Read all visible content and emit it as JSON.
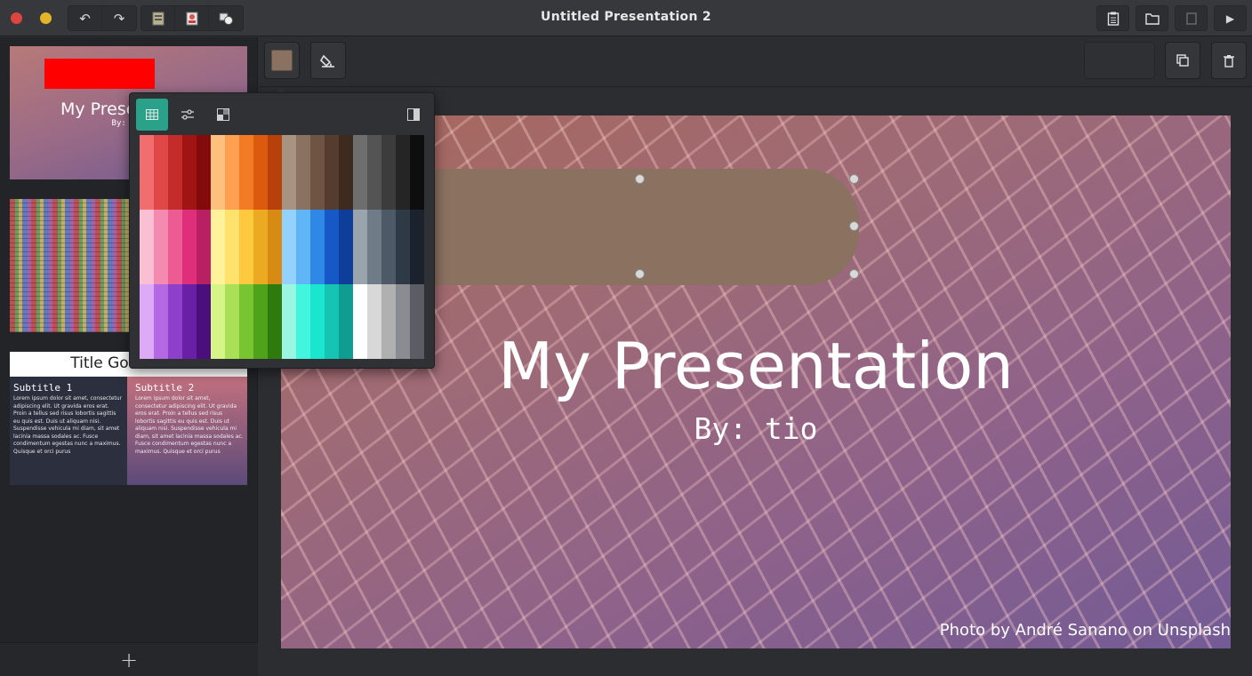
{
  "window": {
    "title": "Untitled Presentation 2"
  },
  "titlebar_icons": {
    "history": [
      "undo-icon",
      "redo-icon"
    ],
    "insert": [
      "text-box-icon",
      "image-icon",
      "shapes-icon"
    ],
    "right": [
      "notes-icon",
      "open-folder-icon",
      "export-icon",
      "play-icon"
    ]
  },
  "glyphs": {
    "undo": "↶",
    "redo": "↷",
    "add": "+",
    "play": "▶"
  },
  "toolbar": {
    "fill_color": "#8a7160",
    "delete_label": "",
    "duplicate_label": ""
  },
  "color_popover": {
    "tabs": [
      "palette-tab",
      "adjust-tab",
      "gradient-tab"
    ],
    "palette": [
      [
        "#f26d6d",
        "#e04848",
        "#c42b2b",
        "#a01414",
        "#840b0b",
        "#ffc07e",
        "#ff9f4f",
        "#f47b25",
        "#dc5a0d",
        "#b8400a",
        "#a89282",
        "#8a7160",
        "#6f5444",
        "#553c2e",
        "#3f2a1f",
        "#6e6e6e",
        "#545454",
        "#3c3c3c",
        "#252525",
        "#0e0e0e"
      ],
      [
        "#fbbfd4",
        "#f58ab0",
        "#ec5c93",
        "#df2e7a",
        "#b91f63",
        "#fff29b",
        "#ffe26b",
        "#fcc93f",
        "#ecaa23",
        "#d78b15",
        "#93d2ff",
        "#5fb5f5",
        "#3088e6",
        "#1658c6",
        "#0e3d9a",
        "#9aa4ad",
        "#6f7b87",
        "#4d5966",
        "#2f3a47",
        "#1b222d"
      ],
      [
        "#dcaaf7",
        "#b568e3",
        "#8e3fcb",
        "#6a20a6",
        "#4a0f7c",
        "#d6f587",
        "#a9e057",
        "#79c531",
        "#4ea31a",
        "#2f7a0c",
        "#9af5e3",
        "#42f5dd",
        "#1ae6cf",
        "#16c4b4",
        "#0f9d91",
        "#ffffff",
        "#d8d8d8",
        "#b0b0b0",
        "#8a8c92",
        "#5a5d63"
      ]
    ]
  },
  "slides": [
    {
      "title": "My Presentation",
      "subtitle": "By: tio"
    },
    {
      "title": "",
      "subtitle": ""
    },
    {
      "title": "Title Goes Here",
      "col1_title": "Subtitle 1",
      "col1_body": "Lorem ipsum dolor sit amet, consectetur adipiscing elit. Ut gravida eros erat. Proin a tellus sed risus lobortis sagittis eu quis est. Duis ut aliquam nisi. Suspendisse vehicula mi diam, sit amet lacinia massa sodales ac. Fusce condimentum egestas nunc a maximus. Quisque et orci purus",
      "col2_title": "Subtitle 2",
      "col2_body": "Lorem ipsum dolor sit amet, consectetur adipiscing elit. Ut gravida eros erat. Proin a tellus sed risus lobortis sagittis eu quis est. Duis ut aliquam nisi. Suspendisse vehicula mi diam, sit amet lacinia massa sodales ac. Fusce condimentum egestas nunc a maximus. Quisque et orci purus"
    }
  ],
  "canvas": {
    "title": "My Presentation",
    "subtitle": "By: tio",
    "credit": "Photo by André Sanano on Unsplash"
  },
  "colors": {
    "accent": "#2aa289",
    "close": "#e0443e",
    "minimize": "#e6b527",
    "red_box": "#ff0000"
  }
}
